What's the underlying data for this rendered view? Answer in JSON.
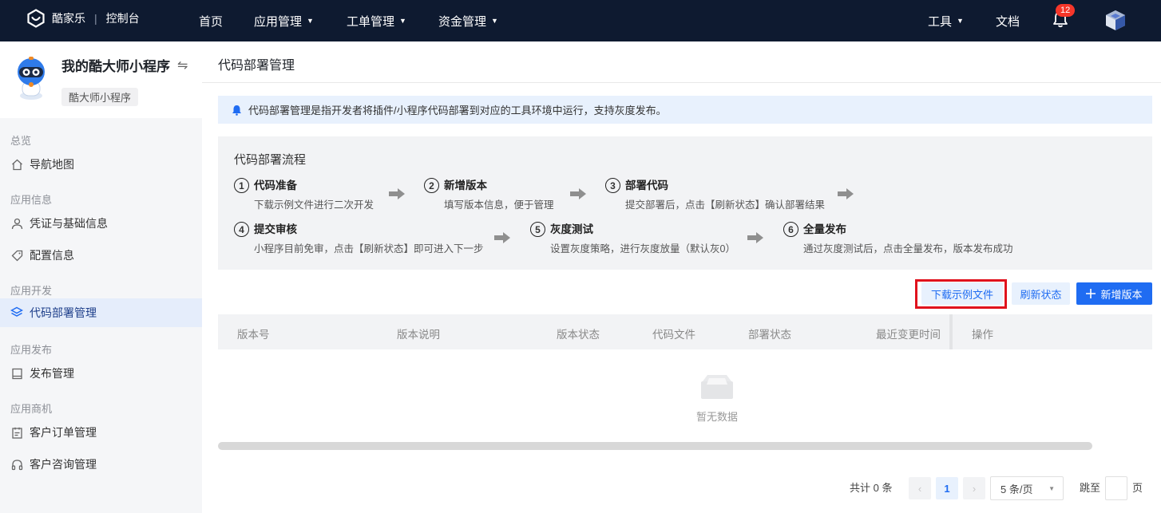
{
  "topbar": {
    "brand": "酷家乐",
    "console": "控制台",
    "nav": [
      "首页",
      "应用管理",
      "工单管理",
      "资金管理"
    ],
    "tools": "工具",
    "docs": "文档",
    "notification_count": "12"
  },
  "sidebar": {
    "app_name": "我的酷大师小程序",
    "app_tag": "酷大师小程序",
    "sections": [
      {
        "title": "总览",
        "items": [
          "导航地图"
        ]
      },
      {
        "title": "应用信息",
        "items": [
          "凭证与基础信息",
          "配置信息"
        ]
      },
      {
        "title": "应用开发",
        "items": [
          "代码部署管理"
        ]
      },
      {
        "title": "应用发布",
        "items": [
          "发布管理"
        ]
      },
      {
        "title": "应用商机",
        "items": [
          "客户订单管理",
          "客户咨询管理"
        ]
      }
    ]
  },
  "main": {
    "title": "代码部署管理",
    "notice": "代码部署管理是指开发者将插件/小程序代码部署到对应的工具环境中运行，支持灰度发布。",
    "flow": {
      "title": "代码部署流程",
      "steps": [
        {
          "num": "1",
          "name": "代码准备",
          "desc": "下载示例文件进行二次开发"
        },
        {
          "num": "2",
          "name": "新增版本",
          "desc": "填写版本信息，便于管理"
        },
        {
          "num": "3",
          "name": "部署代码",
          "desc": "提交部署后，点击【刷新状态】确认部署结果"
        },
        {
          "num": "4",
          "name": "提交审核",
          "desc": "小程序目前免审，点击【刷新状态】即可进入下一步"
        },
        {
          "num": "5",
          "name": "灰度测试",
          "desc": "设置灰度策略，进行灰度放量（默认灰0）"
        },
        {
          "num": "6",
          "name": "全量发布",
          "desc": "通过灰度测试后，点击全量发布，版本发布成功"
        }
      ]
    },
    "actions": {
      "download": "下载示例文件",
      "refresh": "刷新状态",
      "add": "新增版本"
    },
    "table": {
      "columns": [
        "版本号",
        "版本说明",
        "版本状态",
        "代码文件",
        "部署状态",
        "最近变更时间",
        "操作"
      ],
      "empty": "暂无数据"
    },
    "pagination": {
      "total": "共计 0 条",
      "current": "1",
      "page_size": "5 条/页",
      "jump_prefix": "跳至",
      "jump_suffix": "页"
    }
  }
}
